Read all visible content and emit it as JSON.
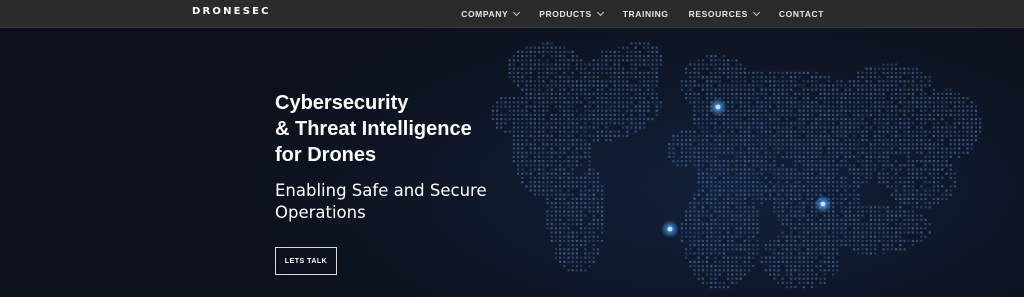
{
  "brand": {
    "logo_text": "DRONESEC"
  },
  "nav": {
    "items": [
      {
        "label": "COMPANY",
        "dropdown": true
      },
      {
        "label": "PRODUCTS",
        "dropdown": true
      },
      {
        "label": "TRAINING",
        "dropdown": false
      },
      {
        "label": "RESOURCES",
        "dropdown": true
      },
      {
        "label": "CONTACT",
        "dropdown": false
      }
    ]
  },
  "hero": {
    "headline_lines": [
      "Cybersecurity",
      "& Threat Intelligence",
      "for Drones"
    ],
    "subtitle_lines": [
      "Enabling Safe and Secure",
      "Operations"
    ],
    "cta_label": "LETS TALK"
  },
  "colors": {
    "nav_background": "#2b2b2c",
    "hero_background": "#0d1320",
    "map_dot": "#3c5f8f",
    "glow": "#4aa8ff"
  }
}
